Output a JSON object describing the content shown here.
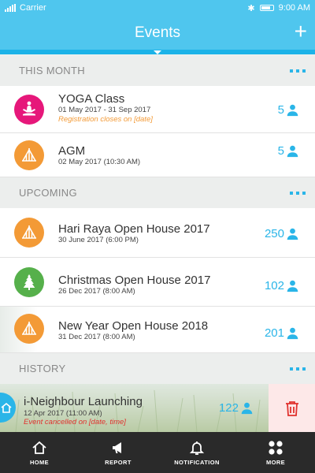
{
  "status_bar": {
    "carrier": "Carrier",
    "time": "9:00 AM"
  },
  "header": {
    "title": "Events",
    "add_icon": "plus-icon"
  },
  "sections": {
    "this_month": "THIS MONTH",
    "upcoming": "UPCOMING",
    "history": "HISTORY"
  },
  "this_month": [
    {
      "name": "YOGA Class",
      "date": "01 May 2017 - 31 Sep 2017",
      "note": "Registration closes on [date]",
      "count": "5",
      "icon": "yoga-icon",
      "color": "#e6177a"
    },
    {
      "name": "AGM",
      "date": "02 May 2017 (10:30 AM)",
      "count": "5",
      "icon": "tent-icon",
      "color": "#f39a36"
    }
  ],
  "upcoming": [
    {
      "name": "Hari Raya Open House 2017",
      "date": "30 June 2017 (6:00 PM)",
      "count": "250",
      "icon": "tent-icon",
      "color": "#f39a36"
    },
    {
      "name": "Christmas Open House 2017",
      "date": "26 Dec 2017 (8:00 AM)",
      "count": "102",
      "icon": "christmas-tree-icon",
      "color": "#56b04b"
    },
    {
      "name": "New Year Open House 2018",
      "date": "31 Dec 2017 (8:00 AM)",
      "count": "201",
      "icon": "tent-icon",
      "color": "#f39a36"
    }
  ],
  "history": [
    {
      "name": "i-Neighbour Launching",
      "date": "12 Apr 2017 (11:00 AM)",
      "note": "Event cancelled on [date, time]",
      "count": "122",
      "icon": "home-icon",
      "color": "#2ab5e8"
    }
  ],
  "tabs": [
    {
      "label": "HOME",
      "icon": "home-icon"
    },
    {
      "label": "REPORT",
      "icon": "megaphone-icon"
    },
    {
      "label": "NOTIFICATION",
      "icon": "bell-icon"
    },
    {
      "label": "MORE",
      "icon": "more-grid-icon"
    }
  ],
  "colors": {
    "accent": "#4fc6ee",
    "count": "#2ab5e8",
    "warning": "#f39a36",
    "danger": "#e0312d"
  }
}
